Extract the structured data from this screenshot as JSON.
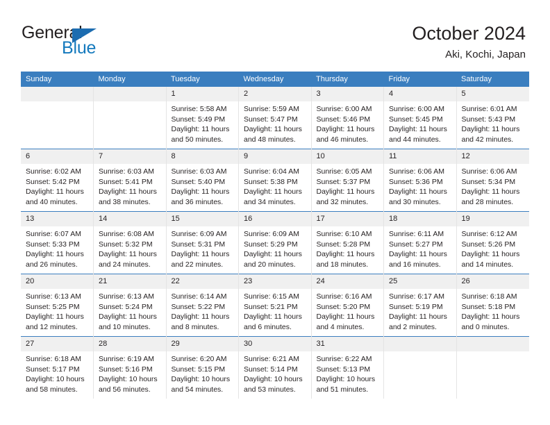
{
  "logo": {
    "word_one": "General",
    "word_two": "Blue",
    "triangle_color": "#1c6cb0",
    "blue_color": "#1479bd"
  },
  "header": {
    "title": "October 2024",
    "subtitle": "Aki, Kochi, Japan",
    "accent_color": "#3a7ebf",
    "daynum_bg": "#f0f0f0"
  },
  "weekdays": [
    "Sunday",
    "Monday",
    "Tuesday",
    "Wednesday",
    "Thursday",
    "Friday",
    "Saturday"
  ],
  "weeks": [
    [
      {
        "day": "",
        "sunrise": "",
        "sunset": "",
        "daylight": "",
        "empty": true
      },
      {
        "day": "",
        "sunrise": "",
        "sunset": "",
        "daylight": "",
        "empty": true
      },
      {
        "day": "1",
        "sunrise": "Sunrise: 5:58 AM",
        "sunset": "Sunset: 5:49 PM",
        "daylight": "Daylight: 11 hours and 50 minutes."
      },
      {
        "day": "2",
        "sunrise": "Sunrise: 5:59 AM",
        "sunset": "Sunset: 5:47 PM",
        "daylight": "Daylight: 11 hours and 48 minutes."
      },
      {
        "day": "3",
        "sunrise": "Sunrise: 6:00 AM",
        "sunset": "Sunset: 5:46 PM",
        "daylight": "Daylight: 11 hours and 46 minutes."
      },
      {
        "day": "4",
        "sunrise": "Sunrise: 6:00 AM",
        "sunset": "Sunset: 5:45 PM",
        "daylight": "Daylight: 11 hours and 44 minutes."
      },
      {
        "day": "5",
        "sunrise": "Sunrise: 6:01 AM",
        "sunset": "Sunset: 5:43 PM",
        "daylight": "Daylight: 11 hours and 42 minutes."
      }
    ],
    [
      {
        "day": "6",
        "sunrise": "Sunrise: 6:02 AM",
        "sunset": "Sunset: 5:42 PM",
        "daylight": "Daylight: 11 hours and 40 minutes."
      },
      {
        "day": "7",
        "sunrise": "Sunrise: 6:03 AM",
        "sunset": "Sunset: 5:41 PM",
        "daylight": "Daylight: 11 hours and 38 minutes."
      },
      {
        "day": "8",
        "sunrise": "Sunrise: 6:03 AM",
        "sunset": "Sunset: 5:40 PM",
        "daylight": "Daylight: 11 hours and 36 minutes."
      },
      {
        "day": "9",
        "sunrise": "Sunrise: 6:04 AM",
        "sunset": "Sunset: 5:38 PM",
        "daylight": "Daylight: 11 hours and 34 minutes."
      },
      {
        "day": "10",
        "sunrise": "Sunrise: 6:05 AM",
        "sunset": "Sunset: 5:37 PM",
        "daylight": "Daylight: 11 hours and 32 minutes."
      },
      {
        "day": "11",
        "sunrise": "Sunrise: 6:06 AM",
        "sunset": "Sunset: 5:36 PM",
        "daylight": "Daylight: 11 hours and 30 minutes."
      },
      {
        "day": "12",
        "sunrise": "Sunrise: 6:06 AM",
        "sunset": "Sunset: 5:34 PM",
        "daylight": "Daylight: 11 hours and 28 minutes."
      }
    ],
    [
      {
        "day": "13",
        "sunrise": "Sunrise: 6:07 AM",
        "sunset": "Sunset: 5:33 PM",
        "daylight": "Daylight: 11 hours and 26 minutes."
      },
      {
        "day": "14",
        "sunrise": "Sunrise: 6:08 AM",
        "sunset": "Sunset: 5:32 PM",
        "daylight": "Daylight: 11 hours and 24 minutes."
      },
      {
        "day": "15",
        "sunrise": "Sunrise: 6:09 AM",
        "sunset": "Sunset: 5:31 PM",
        "daylight": "Daylight: 11 hours and 22 minutes."
      },
      {
        "day": "16",
        "sunrise": "Sunrise: 6:09 AM",
        "sunset": "Sunset: 5:29 PM",
        "daylight": "Daylight: 11 hours and 20 minutes."
      },
      {
        "day": "17",
        "sunrise": "Sunrise: 6:10 AM",
        "sunset": "Sunset: 5:28 PM",
        "daylight": "Daylight: 11 hours and 18 minutes."
      },
      {
        "day": "18",
        "sunrise": "Sunrise: 6:11 AM",
        "sunset": "Sunset: 5:27 PM",
        "daylight": "Daylight: 11 hours and 16 minutes."
      },
      {
        "day": "19",
        "sunrise": "Sunrise: 6:12 AM",
        "sunset": "Sunset: 5:26 PM",
        "daylight": "Daylight: 11 hours and 14 minutes."
      }
    ],
    [
      {
        "day": "20",
        "sunrise": "Sunrise: 6:13 AM",
        "sunset": "Sunset: 5:25 PM",
        "daylight": "Daylight: 11 hours and 12 minutes."
      },
      {
        "day": "21",
        "sunrise": "Sunrise: 6:13 AM",
        "sunset": "Sunset: 5:24 PM",
        "daylight": "Daylight: 11 hours and 10 minutes."
      },
      {
        "day": "22",
        "sunrise": "Sunrise: 6:14 AM",
        "sunset": "Sunset: 5:22 PM",
        "daylight": "Daylight: 11 hours and 8 minutes."
      },
      {
        "day": "23",
        "sunrise": "Sunrise: 6:15 AM",
        "sunset": "Sunset: 5:21 PM",
        "daylight": "Daylight: 11 hours and 6 minutes."
      },
      {
        "day": "24",
        "sunrise": "Sunrise: 6:16 AM",
        "sunset": "Sunset: 5:20 PM",
        "daylight": "Daylight: 11 hours and 4 minutes."
      },
      {
        "day": "25",
        "sunrise": "Sunrise: 6:17 AM",
        "sunset": "Sunset: 5:19 PM",
        "daylight": "Daylight: 11 hours and 2 minutes."
      },
      {
        "day": "26",
        "sunrise": "Sunrise: 6:18 AM",
        "sunset": "Sunset: 5:18 PM",
        "daylight": "Daylight: 11 hours and 0 minutes."
      }
    ],
    [
      {
        "day": "27",
        "sunrise": "Sunrise: 6:18 AM",
        "sunset": "Sunset: 5:17 PM",
        "daylight": "Daylight: 10 hours and 58 minutes."
      },
      {
        "day": "28",
        "sunrise": "Sunrise: 6:19 AM",
        "sunset": "Sunset: 5:16 PM",
        "daylight": "Daylight: 10 hours and 56 minutes."
      },
      {
        "day": "29",
        "sunrise": "Sunrise: 6:20 AM",
        "sunset": "Sunset: 5:15 PM",
        "daylight": "Daylight: 10 hours and 54 minutes."
      },
      {
        "day": "30",
        "sunrise": "Sunrise: 6:21 AM",
        "sunset": "Sunset: 5:14 PM",
        "daylight": "Daylight: 10 hours and 53 minutes."
      },
      {
        "day": "31",
        "sunrise": "Sunrise: 6:22 AM",
        "sunset": "Sunset: 5:13 PM",
        "daylight": "Daylight: 10 hours and 51 minutes."
      },
      {
        "day": "",
        "sunrise": "",
        "sunset": "",
        "daylight": "",
        "empty": true
      },
      {
        "day": "",
        "sunrise": "",
        "sunset": "",
        "daylight": "",
        "empty": true
      }
    ]
  ]
}
